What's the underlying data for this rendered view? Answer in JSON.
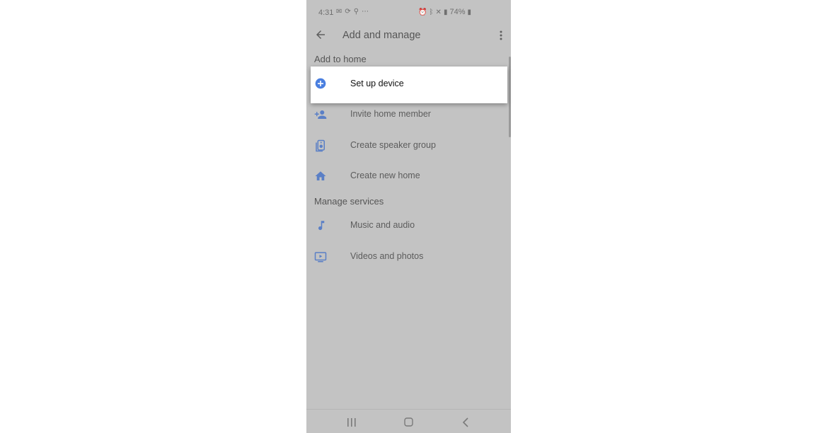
{
  "status_bar": {
    "time": "4:31",
    "battery": "74%"
  },
  "app_bar": {
    "title": "Add and manage"
  },
  "sections": {
    "add_to_home": {
      "header": "Add to home",
      "items": [
        {
          "label": "Set up device",
          "icon": "add-circle-icon"
        },
        {
          "label": "Invite home member",
          "icon": "person-add-icon"
        },
        {
          "label": "Create speaker group",
          "icon": "speaker-icon"
        },
        {
          "label": "Create new home",
          "icon": "home-icon"
        }
      ]
    },
    "manage_services": {
      "header": "Manage services",
      "items": [
        {
          "label": "Music and audio",
          "icon": "music-note-icon"
        },
        {
          "label": "Videos and photos",
          "icon": "video-icon"
        }
      ]
    }
  },
  "colors": {
    "overlay_bg": "#c3c3c3",
    "accent_blue": "#4a7fe0",
    "dim_blue": "#5a7fc6"
  }
}
